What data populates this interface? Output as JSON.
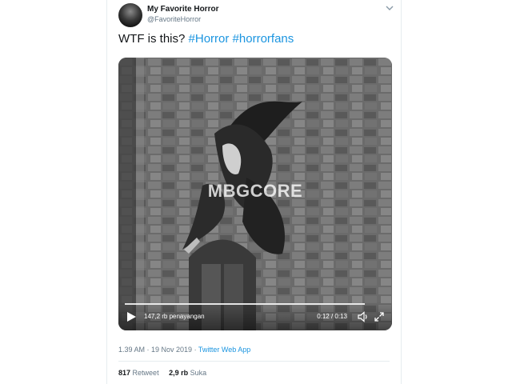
{
  "author": {
    "name": "My Favorite Horror",
    "handle": "@FavoriteHorror"
  },
  "tweet": {
    "text": "WTF is this?",
    "hashtags": [
      "#Horror",
      "#horrorfans"
    ]
  },
  "video": {
    "watermark": "MBGCORE",
    "views": "147,2 rb penayangan",
    "time": "0:12 / 0:13",
    "progress": 0.92
  },
  "meta": {
    "datetime": "1.39 AM · 19 Nov 2019",
    "separator": " · ",
    "source": "Twitter Web App"
  },
  "stats": {
    "retweets_count": "817",
    "retweets_label": "Retweet",
    "likes_count": "2,9 rb",
    "likes_label": "Suka"
  },
  "icons": {
    "menu": "chevron-down-icon",
    "play": "play-icon",
    "volume": "volume-icon",
    "fullscreen": "fullscreen-icon"
  },
  "colors": {
    "link": "#1b95e0",
    "text": "#14171a",
    "secondary": "#657786"
  }
}
